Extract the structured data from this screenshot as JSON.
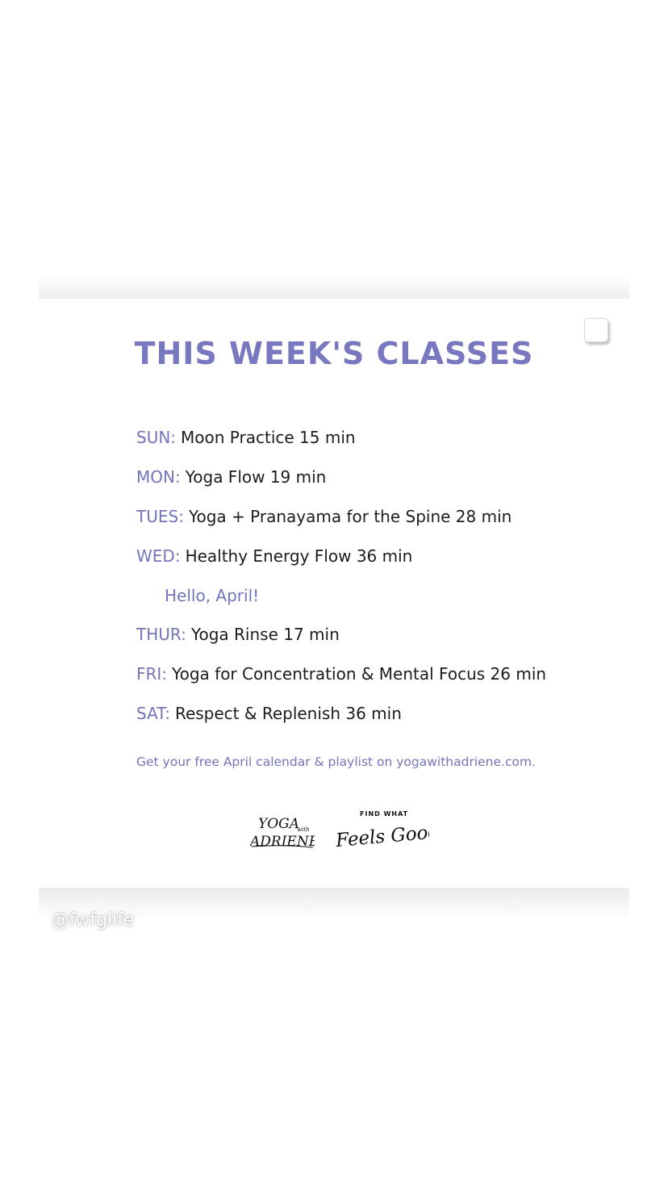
{
  "card": {
    "title": "THIS WEEK'S CLASSES",
    "schedule": [
      {
        "day": "SUN:",
        "class": "Moon Practice 15 min"
      },
      {
        "day": "MON:",
        "class": "Yoga Flow 19 min"
      },
      {
        "day": "TUES:",
        "class": "Yoga + Pranayama for the Spine 28 min"
      },
      {
        "day": "WED:",
        "class": "Healthy Energy Flow 36 min"
      },
      {
        "note": "Hello, April!"
      },
      {
        "day": "THUR:",
        "class": "Yoga Rinse 17 min"
      },
      {
        "day": "FRI:",
        "class": "Yoga for Concentration & Mental Focus 26 min"
      },
      {
        "day": "SAT:",
        "class": "Respect & Replenish 36 min"
      }
    ],
    "footer_note": "Get your free April calendar & playlist on yogawithadriene.com.",
    "logos": {
      "yoga_with_adriene": {
        "line1": "YOGA",
        "with": "with",
        "line2": "ADRIENE"
      },
      "find_what_feels_good": {
        "top": "FIND WHAT",
        "script": "Feels Good"
      }
    }
  },
  "watermark": "@fwfglife",
  "colors": {
    "accent": "#7474bb",
    "title": "#7878c0",
    "body_text": "#1c1c1c",
    "background": "#ffffff"
  }
}
